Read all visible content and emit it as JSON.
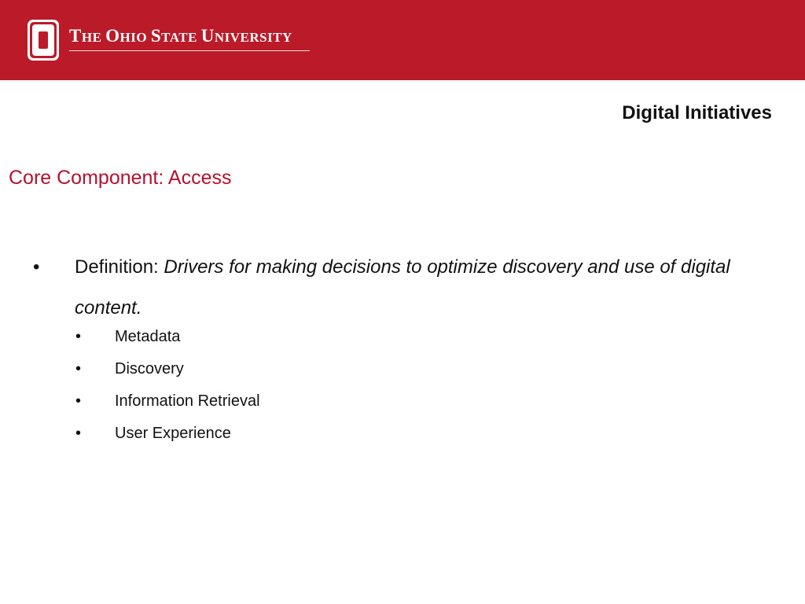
{
  "header": {
    "university_name": "The Ohio State University",
    "brand_color": "#bb1a28",
    "logo_icon": "block-o-logo-icon"
  },
  "section_title": "Digital Initiatives",
  "heading": "Core Component: Access",
  "heading_color": "#b4122e",
  "definition": {
    "label": "Definition:",
    "text": "Drivers for making decisions to optimize discovery and use of digital content."
  },
  "sub_items": [
    "Metadata",
    "Discovery",
    "Information Retrieval",
    "User Experience"
  ]
}
